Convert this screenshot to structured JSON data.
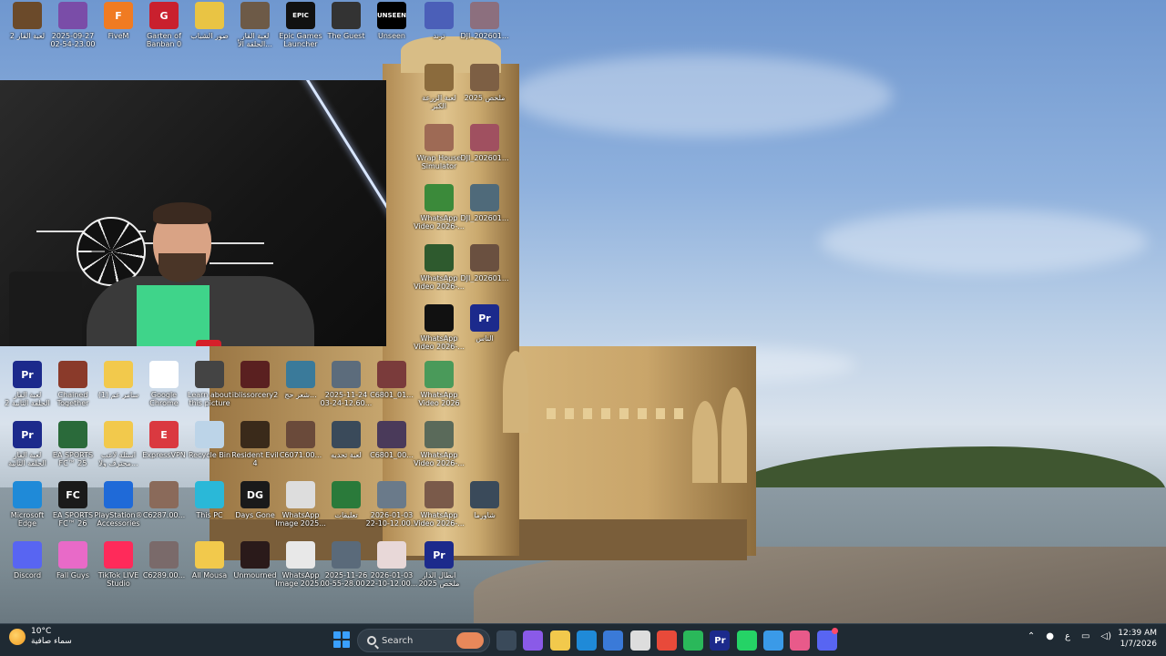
{
  "desktop": {
    "icons": [
      {
        "id": "i1",
        "label": "لعبة القار 2",
        "color": "#6b4a2a",
        "glyph": ""
      },
      {
        "id": "i2",
        "label": "2025-09-27\n02-54-23.00",
        "color": "#7a4da8",
        "glyph": ""
      },
      {
        "id": "i3",
        "label": "FiveM",
        "color": "#f07b22",
        "glyph": "F"
      },
      {
        "id": "i4",
        "label": "Garten of\nBanban 0",
        "color": "#c9202e",
        "glyph": "G"
      },
      {
        "id": "i5",
        "label": "صور الشباب",
        "color": "#e9c444",
        "glyph": ""
      },
      {
        "id": "i6",
        "label": "لعبة القار\nالحلقة الأ...",
        "color": "#6d5a47",
        "glyph": ""
      },
      {
        "id": "i7",
        "label": "Epic Games\nLauncher",
        "color": "#111111",
        "glyph": "EPIC"
      },
      {
        "id": "i8",
        "label": "The Guest",
        "color": "#333333",
        "glyph": ""
      },
      {
        "id": "i9",
        "label": "Unseen",
        "color": "#000000",
        "glyph": "UNSEEN"
      },
      {
        "id": "i10",
        "label": "ترند",
        "color": "#4b5fb8",
        "glyph": ""
      },
      {
        "id": "i11",
        "label": "DJI_202601...",
        "color": "#8c6f7e",
        "glyph": ""
      },
      {
        "id": "i12",
        "label": "لعبة الزرعة\nالكبر",
        "color": "#8b6b3d",
        "glyph": ""
      },
      {
        "id": "i13",
        "label": "ملخص 2025",
        "color": "#7d5f44",
        "glyph": ""
      },
      {
        "id": "i14",
        "label": "Wrap House\nSimulator",
        "color": "#9e6a55",
        "glyph": ""
      },
      {
        "id": "i15",
        "label": "DJI_202601...",
        "color": "#a05060",
        "glyph": ""
      },
      {
        "id": "i16",
        "label": "WhatsApp\nVideo 2026-...",
        "color": "#3b8a3a",
        "glyph": ""
      },
      {
        "id": "i17",
        "label": "DJI_202601...",
        "color": "#4f6a7a",
        "glyph": ""
      },
      {
        "id": "i18",
        "label": "WhatsApp\nVideo 2026-...",
        "color": "#2e5a2e",
        "glyph": ""
      },
      {
        "id": "i19",
        "label": "DJI_202601...",
        "color": "#6a5040",
        "glyph": ""
      },
      {
        "id": "i20",
        "label": "WhatsApp\nVideo 2026-...",
        "color": "#111111",
        "glyph": ""
      },
      {
        "id": "i21",
        "label": "الناس",
        "color": "#1c2a8c",
        "glyph": "Pr"
      },
      {
        "id": "i22",
        "label": "لعبة القار\nالحلقة الثانية 2",
        "color": "#1c2a8c",
        "glyph": "Pr"
      },
      {
        "id": "i23",
        "label": "Chained\nTogether",
        "color": "#8a3a2a",
        "glyph": ""
      },
      {
        "id": "i24",
        "label": "(1) سامر عم",
        "color": "#f2c94c",
        "glyph": ""
      },
      {
        "id": "i25",
        "label": "Google\nChrome",
        "color": "#ffffff",
        "glyph": ""
      },
      {
        "id": "i26",
        "label": "Learn about\nthis picture",
        "color": "#444444",
        "glyph": ""
      },
      {
        "id": "i27",
        "label": "iblissorcery2",
        "color": "#5a2020",
        "glyph": ""
      },
      {
        "id": "i28",
        "label": "شعر حج...",
        "color": "#3a7a9a",
        "glyph": ""
      },
      {
        "id": "i29",
        "label": "2025-11-24\n03-24-12.60...",
        "color": "#5c6c7c",
        "glyph": ""
      },
      {
        "id": "i30",
        "label": "C6801_01...",
        "color": "#7a3b3b",
        "glyph": ""
      },
      {
        "id": "i31",
        "label": "WhatsApp\nVideo 2026",
        "color": "#4a9a5a",
        "glyph": ""
      },
      {
        "id": "i32",
        "label": "لعبة القار\nالحلقة الثانية",
        "color": "#1c2a8c",
        "glyph": "Pr"
      },
      {
        "id": "i33",
        "label": "EA SPORTS\nFC™ 25",
        "color": "#2a6a3a",
        "glyph": ""
      },
      {
        "id": "i34",
        "label": "اسئلة لاعب\nمحترف ولا...",
        "color": "#f2c94c",
        "glyph": ""
      },
      {
        "id": "i35",
        "label": "ExpressVPN",
        "color": "#da3940",
        "glyph": "E"
      },
      {
        "id": "i36",
        "label": "Recycle Bin",
        "color": "#bcd4e8",
        "glyph": ""
      },
      {
        "id": "i37",
        "label": "Resident Evil\n4",
        "color": "#3a2a1a",
        "glyph": ""
      },
      {
        "id": "i38",
        "label": "C6071.00...",
        "color": "#6a4a3a",
        "glyph": ""
      },
      {
        "id": "i39",
        "label": "لعبة تحديه",
        "color": "#3a4a5a",
        "glyph": ""
      },
      {
        "id": "i40",
        "label": "C6801_00...",
        "color": "#4a3a5a",
        "glyph": ""
      },
      {
        "id": "i41",
        "label": "WhatsApp\nVideo 2026-...",
        "color": "#5a6a5a",
        "glyph": ""
      },
      {
        "id": "i42",
        "label": "Microsoft\nEdge",
        "color": "#1f8ad8",
        "glyph": ""
      },
      {
        "id": "i43",
        "label": "EA SPORTS\nFC™ 26",
        "color": "#1a1a1a",
        "glyph": "FC"
      },
      {
        "id": "i44",
        "label": "PlayStation®\nAccessories",
        "color": "#1f6ad8",
        "glyph": ""
      },
      {
        "id": "i45",
        "label": "C6287.00...",
        "color": "#8a6a5a",
        "glyph": ""
      },
      {
        "id": "i46",
        "label": "This PC",
        "color": "#2ab8d8",
        "glyph": ""
      },
      {
        "id": "i47",
        "label": "Days Gone",
        "color": "#1a1a1a",
        "glyph": "DG"
      },
      {
        "id": "i48",
        "label": "WhatsApp\nImage 2025...",
        "color": "#dddddd",
        "glyph": ""
      },
      {
        "id": "i49",
        "label": "تعليقات",
        "color": "#2a7a3a",
        "glyph": ""
      },
      {
        "id": "i50",
        "label": "2026-01-03\n22-10-12.00...",
        "color": "#6a7a8a",
        "glyph": ""
      },
      {
        "id": "i51",
        "label": "WhatsApp\nVideo 2026-...",
        "color": "#7a5a4a",
        "glyph": ""
      },
      {
        "id": "i52",
        "label": "شاورما",
        "color": "#3a4a5a",
        "glyph": ""
      },
      {
        "id": "i53",
        "label": "Discord",
        "color": "#5865f2",
        "glyph": ""
      },
      {
        "id": "i54",
        "label": "Fall Guys",
        "color": "#e86ac8",
        "glyph": ""
      },
      {
        "id": "i55",
        "label": "TikTok LIVE\nStudio",
        "color": "#ff2a5a",
        "glyph": ""
      },
      {
        "id": "i56",
        "label": "C6289.00...",
        "color": "#7a6a6a",
        "glyph": ""
      },
      {
        "id": "i57",
        "label": "All Mousa",
        "color": "#f2c94c",
        "glyph": ""
      },
      {
        "id": "i58",
        "label": "Unmourned",
        "color": "#2a1a1a",
        "glyph": ""
      },
      {
        "id": "i59",
        "label": "WhatsApp\nImage 2025...",
        "color": "#e8e8e8",
        "glyph": ""
      },
      {
        "id": "i60",
        "label": "2025-11-26\n00-55-28.00...",
        "color": "#5a6a7a",
        "glyph": ""
      },
      {
        "id": "i61",
        "label": "2026-01-03\n22-10-12.00...",
        "color": "#e8d8d8",
        "glyph": ""
      },
      {
        "id": "i62",
        "label": "ابطال الدار\nملخص 2025",
        "color": "#1c2a8c",
        "glyph": "Pr"
      }
    ]
  },
  "taskbar": {
    "weather_temp": "10°C",
    "weather_desc": "سماء صافية",
    "search_label": "Search",
    "lang_indicator": "ع",
    "time": "12:39 AM",
    "date": "1/7/2026",
    "apps": [
      {
        "name": "task-view",
        "color": "#3a4a5a",
        "glyph": ""
      },
      {
        "name": "copilot",
        "color": "#8a5ae8",
        "glyph": ""
      },
      {
        "name": "file-explorer",
        "color": "#f2c94c",
        "glyph": ""
      },
      {
        "name": "edge",
        "color": "#1f8ad8",
        "glyph": ""
      },
      {
        "name": "store",
        "color": "#3a7ad8",
        "glyph": ""
      },
      {
        "name": "bubble",
        "color": "#dddddd",
        "glyph": ""
      },
      {
        "name": "chrome",
        "color": "#e84a3a",
        "glyph": ""
      },
      {
        "name": "green-app",
        "color": "#2ab85a",
        "glyph": ""
      },
      {
        "name": "premiere",
        "color": "#1c2a8c",
        "glyph": "Pr"
      },
      {
        "name": "whatsapp",
        "color": "#25d366",
        "glyph": ""
      },
      {
        "name": "circle-app",
        "color": "#3a9ae8",
        "glyph": ""
      },
      {
        "name": "music",
        "color": "#e85a8a",
        "glyph": ""
      },
      {
        "name": "discord",
        "color": "#5865f2",
        "glyph": ""
      }
    ]
  }
}
